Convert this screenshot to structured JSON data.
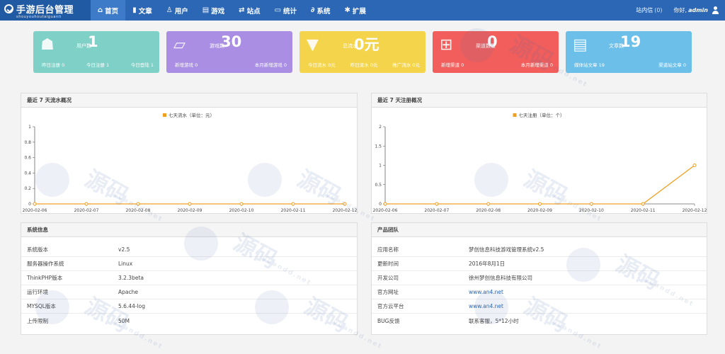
{
  "nav": {
    "logo_title": "手游后台管理",
    "logo_sub": "shouyouhoutaiguanli",
    "items": [
      {
        "label": "首页",
        "icon": "⌂",
        "active": true,
        "name": "home"
      },
      {
        "label": "文章",
        "icon": "▮",
        "name": "articles"
      },
      {
        "label": "用户",
        "icon": "♙",
        "name": "users"
      },
      {
        "label": "游戏",
        "icon": "▤",
        "name": "games"
      },
      {
        "label": "站点",
        "icon": "⇄",
        "name": "sites"
      },
      {
        "label": "统计",
        "icon": "▭",
        "name": "stats"
      },
      {
        "label": "系统",
        "icon": "∂",
        "name": "system"
      },
      {
        "label": "扩展",
        "icon": "✱",
        "name": "extend"
      }
    ],
    "messages_label": "站内信",
    "messages_count": "(0)",
    "greeting": "你好,",
    "username": "admin"
  },
  "cards": [
    {
      "label": "用户数",
      "value": "1",
      "color": "#7fd0c7",
      "icon": "☗",
      "foot": [
        "昨日注册 0",
        "今日注册 1",
        "今日登陆 1"
      ]
    },
    {
      "label": "游戏数",
      "value": "30",
      "color": "#a98ee3",
      "icon": "▱",
      "foot": [
        "新增游戏 0",
        "本月新增游戏 0"
      ]
    },
    {
      "label": "总流水",
      "value": "0元",
      "color": "#f4d44a",
      "icon": "▼",
      "foot": [
        "今日流水 0元",
        "昨日流水 0元",
        "推广流水 0元"
      ]
    },
    {
      "label": "渠道数量",
      "value": "0",
      "color": "#f15e5b",
      "icon": "⊞",
      "foot": [
        "新增渠道 0",
        "本月新增渠道 0"
      ]
    },
    {
      "label": "文章数",
      "value": "19",
      "color": "#6cbfe9",
      "icon": "▤",
      "foot": [
        "媒体站文章 19",
        "渠道站文章 0"
      ]
    }
  ],
  "panels": {
    "flow_title": "最近 7 天流水概况",
    "reg_title": "最近 7 天注册概况",
    "system_title": "系统信息",
    "team_title": "产品团队"
  },
  "chart_data": [
    {
      "type": "line",
      "x": [
        "2020-02-06",
        "2020-02-07",
        "2020-02-08",
        "2020-02-09",
        "2020-02-10",
        "2020-02-11",
        "2020-02-12"
      ],
      "series": [
        {
          "name": "七天流水（单位：元）",
          "values": [
            0,
            0,
            0,
            0,
            0,
            0,
            0
          ],
          "color": "#f0a020"
        }
      ],
      "yticks": [
        "0",
        "0.2",
        "0.4",
        "0.6",
        "0.8",
        "1"
      ],
      "ylim": [
        0,
        1
      ],
      "grid": false,
      "legend": "top-center"
    },
    {
      "type": "line",
      "x": [
        "2020-02-06",
        "2020-02-07",
        "2020-02-08",
        "2020-02-09",
        "2020-02-10",
        "2020-02-11",
        "2020-02-12"
      ],
      "series": [
        {
          "name": "七天注册（单位：个）",
          "values": [
            0,
            0,
            0,
            0,
            0,
            0,
            1
          ],
          "color": "#f0a020"
        }
      ],
      "yticks": [
        "0",
        "0.5",
        "1",
        "1.5",
        "2"
      ],
      "ylim": [
        0,
        2
      ],
      "grid": false,
      "legend": "top-center"
    }
  ],
  "system_info": [
    [
      "系统版本",
      "v2.5"
    ],
    [
      "服务器操作系统",
      "Linux"
    ],
    [
      "ThinkPHP版本",
      "3.2.3beta"
    ],
    [
      "运行环境",
      "Apache"
    ],
    [
      "MYSQL版本",
      "5.6.44-log"
    ],
    [
      "上传限制",
      "50M"
    ]
  ],
  "team_info": [
    [
      "应用名称",
      "梦创信息科技游戏管理系统v2.5",
      false
    ],
    [
      "更新时间",
      "2016年8月1日",
      false
    ],
    [
      "开发公司",
      "徐州梦创信息科技有限公司",
      false
    ],
    [
      "官方网址",
      "www.an4.net",
      true
    ],
    [
      "官方云平台",
      "www.an4.net",
      true
    ],
    [
      "BUG反馈",
      "联系客服，5*12小时",
      false
    ]
  ],
  "watermark": {
    "text": "源码",
    "sub": "yuandd.net"
  }
}
